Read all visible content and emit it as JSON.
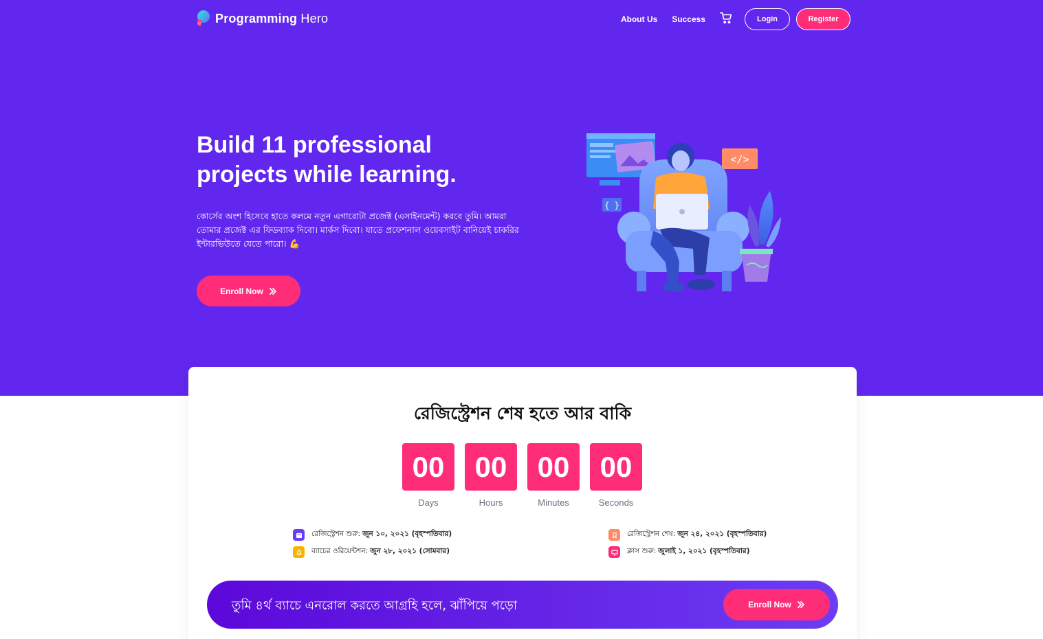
{
  "brand": {
    "name_bold": "Programming",
    "name_light": "Hero",
    "logo_icon": "rocket-icon"
  },
  "nav": {
    "links": [
      "About Us",
      "Success"
    ],
    "cart_icon": "cart-icon",
    "login_label": "Login",
    "register_label": "Register"
  },
  "hero": {
    "title": "Build 11 professional projects while learning.",
    "description": "কোর্সের অংশ হিসেবে হাতে কলমে নতুন এগারোটা প্রজেক্ট (এসাইনমেন্ট) করবে তুমি। আমরা তোমার প্রজেক্ট এর ফিডব্যাক দিবো। মার্কস দিবো। যাতে প্রফেশনাল ওয়েবসাইট বানিয়েই চাকরির ইন্টারভিউতে যেতে পারো। 💪",
    "enroll_label": "Enroll Now",
    "enroll_icon": "double-chevron-right-icon"
  },
  "countdown": {
    "title": "রেজিস্ট্রেশন শেষ হতে আর বাকি",
    "units": [
      {
        "value": "00",
        "label": "Days"
      },
      {
        "value": "00",
        "label": "Hours"
      },
      {
        "value": "00",
        "label": "Minutes"
      },
      {
        "value": "00",
        "label": "Seconds"
      }
    ]
  },
  "dates": {
    "left": [
      {
        "label": "রেজিস্ট্রেশন শুরু:",
        "value": "জুন ১০, ২০২১ (বৃহস্পতিবার)",
        "icon": "calendar-icon",
        "color": "#6a3df0"
      },
      {
        "label": "ব্যাচের ওরিয়েন্টশন:",
        "value": "জুন ২৮, ২০২১ (সোমবার)",
        "icon": "bell-icon",
        "color": "#f7b500"
      }
    ],
    "right": [
      {
        "label": "রেজিস্ট্রেশন শেষ:",
        "value": "জুন ২৪, ২০২১ (বৃহস্পতিবার)",
        "icon": "bookmark-icon",
        "color": "#ff8a65"
      },
      {
        "label": "ক্লাস শুরু:",
        "value": "জুলাই ১, ২০২১ (বৃহস্পতিবার)",
        "icon": "monitor-icon",
        "color": "#ff2c78"
      }
    ]
  },
  "cta": {
    "text": "তুমি ৪র্থ ব্যাচে এনরোল করতে আগ্রহি হলে, ঝাঁপিয়ে পড়ো",
    "enroll_label": "Enroll Now"
  },
  "colors": {
    "hero_bg": "#6127ee",
    "accent": "#ff2c78",
    "text_dark": "#111111"
  }
}
